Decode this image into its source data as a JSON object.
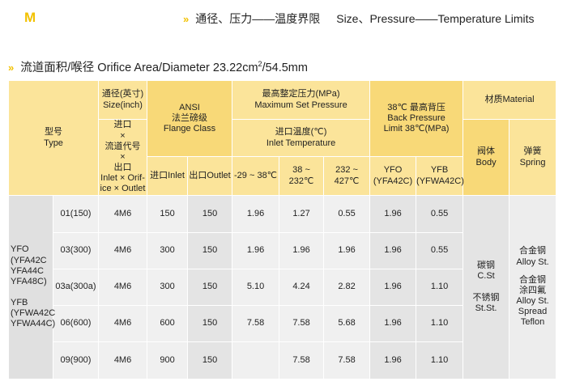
{
  "header": {
    "letter": "M",
    "title_cn": "通径、压力——温度界限",
    "title_en": "Size、Pressure——Temperature Limits",
    "sub_prefix": "流道面积/喉径 Orifice Area/Diameter 23.22cm",
    "sub_sup": "2",
    "sub_suffix": "/54.5mm"
  },
  "table": {
    "h_type_cn": "型号",
    "h_type_en": "Type",
    "h_size_cn": "通径(英寸)",
    "h_size_en": "Size(inch)",
    "h_code_cn1": "进口",
    "h_code_x1": "×",
    "h_code_cn2": "流道代号",
    "h_code_x2": "×",
    "h_code_cn3": "出口",
    "h_code_en1": "Inlet × Orif-",
    "h_code_en2": "ice × Outlet",
    "h_ansi1": "ANSI",
    "h_ansi2": "法兰磅级",
    "h_ansi3": "Flange Class",
    "h_inlet": "进口Inlet",
    "h_outlet": "出口Outlet",
    "h_maxset_cn": "最高整定压力(MPa)",
    "h_maxset_en": "Maximum Set Pressure",
    "h_temp_cn": "进口温度(℃)",
    "h_temp_en": "Inlet Temperature",
    "h_t1": "-29 ~ 38℃",
    "h_t2": "38 ~ 232℃",
    "h_t3": "232 ~ 427℃",
    "h_back_1": "38℃ 最高背压",
    "h_back_2": "Back Pressure",
    "h_back_3": "Limit 38℃(MPa)",
    "h_yfo1": "YFO",
    "h_yfo2": "(YFA42C)",
    "h_yfb1": "YFB",
    "h_yfb2": "(YFWA42C)",
    "h_material": "材质Material",
    "h_body_cn": "阀体",
    "h_body_en": "Body",
    "h_spring_cn": "弹簧",
    "h_spring_en": "Spring",
    "type_lines": [
      "YFO",
      "(YFA42C",
      "YFA44C",
      "YFA48C)",
      "",
      "YFB",
      "(YFWA42C",
      "YFWA44C)"
    ],
    "rows": [
      {
        "size": "01(150)",
        "code": "4M6",
        "inlet": "150",
        "outlet": "150",
        "t1": "1.96",
        "t2": "1.27",
        "t3": "0.55",
        "yfo": "1.96",
        "yfb": "0.55"
      },
      {
        "size": "03(300)",
        "code": "4M6",
        "inlet": "300",
        "outlet": "150",
        "t1": "1.96",
        "t2": "1.96",
        "t3": "1.96",
        "yfo": "1.96",
        "yfb": "0.55"
      },
      {
        "size": "03a(300a)",
        "code": "4M6",
        "inlet": "300",
        "outlet": "150",
        "t1": "5.10",
        "t2": "4.24",
        "t3": "2.82",
        "yfo": "1.96",
        "yfb": "1.10"
      },
      {
        "size": "06(600)",
        "code": "4M6",
        "inlet": "600",
        "outlet": "150",
        "t1": "7.58",
        "t2": "7.58",
        "t3": "5.68",
        "yfo": "1.96",
        "yfb": "1.10"
      },
      {
        "size": "09(900)",
        "code": "4M6",
        "inlet": "900",
        "outlet": "150",
        "t1": "",
        "t2": "7.58",
        "t3": "7.58",
        "yfo": "1.96",
        "yfb": "1.10"
      }
    ],
    "body_material": [
      "碳钢",
      "C.St",
      "",
      "不锈钢",
      "St.St."
    ],
    "spring_material": [
      "合金钢",
      "Alloy St.",
      "",
      "合金钢",
      "涂四氟",
      "Alloy St.",
      "Spread",
      "Teflon"
    ]
  }
}
